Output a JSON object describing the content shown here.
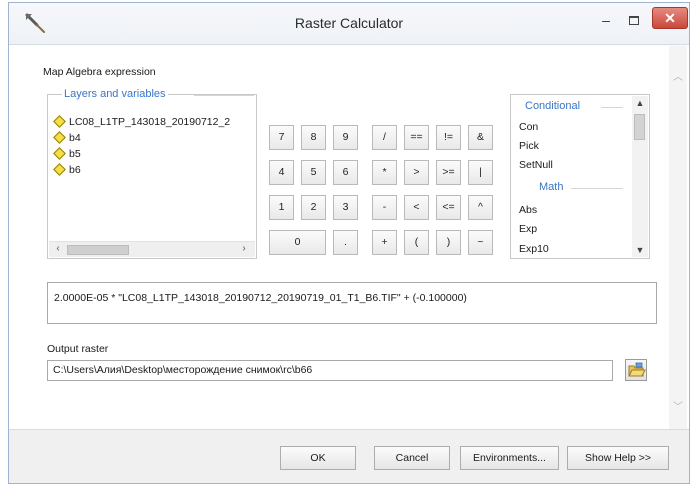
{
  "window": {
    "title": "Raster Calculator"
  },
  "title_controls": {
    "minimize": "–",
    "close": "✕"
  },
  "map_algebra_label": "Map Algebra expression",
  "layers_panel": {
    "legend": "Layers and variables",
    "items": [
      "LC08_L1TP_143018_20190712_2",
      "b4",
      "b5",
      "b6"
    ]
  },
  "keypad": {
    "rows": [
      [
        "7",
        "8",
        "9",
        "/",
        "==",
        "!=",
        "&"
      ],
      [
        "4",
        "5",
        "6",
        "*",
        ">",
        ">=",
        "|"
      ],
      [
        "1",
        "2",
        "3",
        "-",
        "<",
        "<=",
        "^"
      ],
      [
        "0",
        ".",
        "+",
        "(",
        ")",
        "~"
      ]
    ]
  },
  "functions_panel": {
    "conditional_header": "Conditional",
    "conditional_items": [
      "Con",
      "Pick",
      "SetNull"
    ],
    "math_header": "Math",
    "math_items": [
      "Abs",
      "Exp",
      "Exp10"
    ]
  },
  "expression": "2.0000E-05 * \"LC08_L1TP_143018_20190712_20190719_01_T1_B6.TIF\" + (-0.100000)",
  "output": {
    "label": "Output raster",
    "value": "C:\\Users\\Алия\\Desktop\\месторождение снимок\\rc\\b66"
  },
  "buttons": {
    "ok": "OK",
    "cancel": "Cancel",
    "environments": "Environments...",
    "show_help": "Show Help >>"
  }
}
